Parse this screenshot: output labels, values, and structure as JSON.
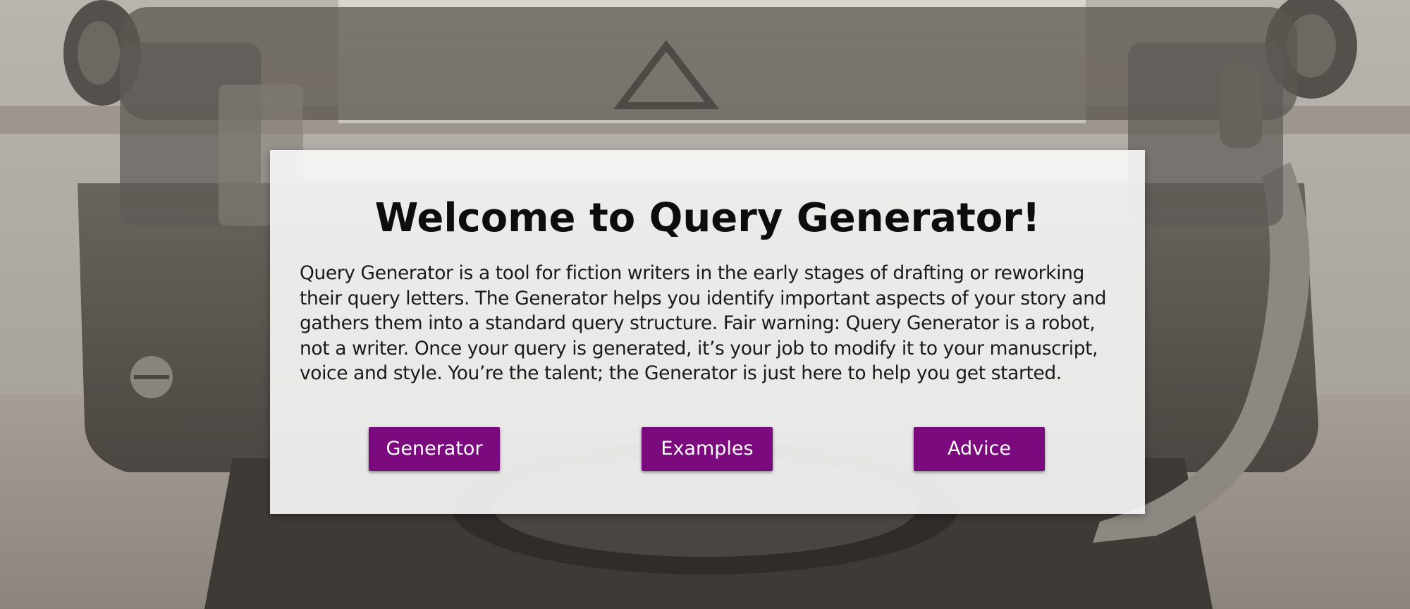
{
  "hero": {
    "title": "Welcome to Query Generator!",
    "intro": "Query Generator is a tool for fiction writers in the early stages of drafting or reworking their query letters. The Generator helps you identify important aspects of your story and gathers them into a standard query structure. Fair warning: Query Generator is a robot, not a writer. Once your query is generated, it’s your job to modify it to your manuscript, voice and style. You’re the talent; the Generator is just here to help you get started."
  },
  "nav": {
    "generator_label": "Generator",
    "examples_label": "Examples",
    "advice_label": "Advice"
  },
  "colors": {
    "button": "#7b0a7f",
    "card": "#f8f8f8",
    "background_tint": "#8f8880"
  },
  "background_image": "sepia-typewriter-photo"
}
